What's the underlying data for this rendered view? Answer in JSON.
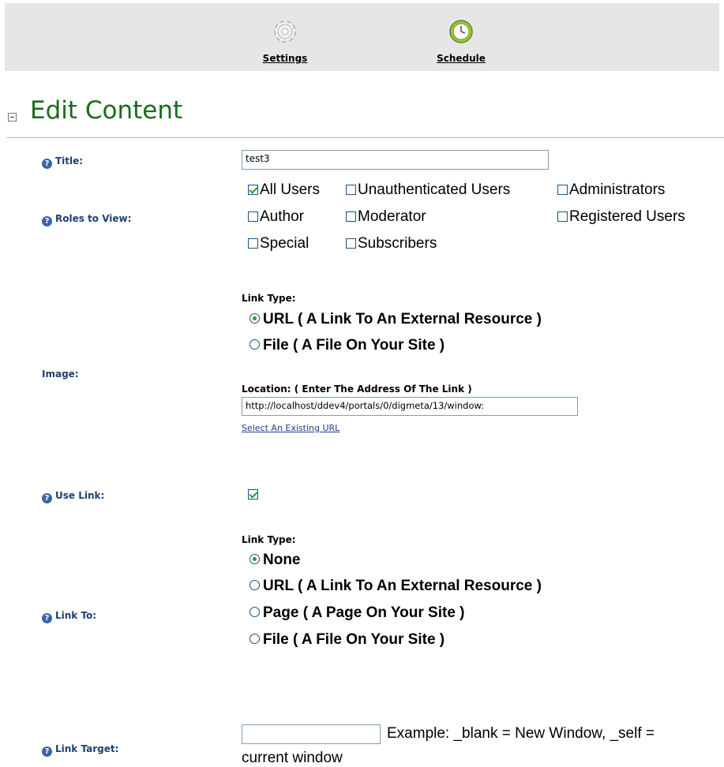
{
  "toolbar": {
    "settings_label": "Settings",
    "schedule_label": "Schedule"
  },
  "section": {
    "title": "Edit Content"
  },
  "fields": {
    "title": {
      "label": "Title:",
      "value": "test3"
    },
    "roles": {
      "label": "Roles to View:",
      "items": [
        {
          "label": "All Users",
          "checked": true
        },
        {
          "label": "Unauthenticated Users",
          "checked": false
        },
        {
          "label": "Administrators",
          "checked": false
        },
        {
          "label": "Author",
          "checked": false
        },
        {
          "label": "Moderator",
          "checked": false
        },
        {
          "label": "Registered Users",
          "checked": false
        },
        {
          "label": "Special",
          "checked": false
        },
        {
          "label": "Subscribers",
          "checked": false
        }
      ]
    },
    "image": {
      "label": "Image:",
      "link_type_label": "Link Type:",
      "options": [
        {
          "label": "URL ( A Link To An External Resource )",
          "selected": true
        },
        {
          "label": "File ( A File On Your Site )",
          "selected": false
        }
      ],
      "location_label": "Location: ( Enter The Address Of The Link )",
      "location_value": "http://localhost/ddev4/portals/0/digmeta/13/window:",
      "select_existing": "Select An Existing URL"
    },
    "use_link": {
      "label": "Use Link:",
      "checked": true
    },
    "link_to": {
      "label": "Link To:",
      "link_type_label": "Link Type:",
      "options": [
        {
          "label": "None",
          "selected": true
        },
        {
          "label": "URL ( A Link To An External Resource )",
          "selected": false
        },
        {
          "label": "Page ( A Page On Your Site )",
          "selected": false
        },
        {
          "label": "File ( A File On Your Site )",
          "selected": false
        }
      ]
    },
    "link_target": {
      "label": "Link Target:",
      "value": "",
      "hint_line1": "Example: _blank = New Window, _self =",
      "hint_line2": "current window"
    }
  },
  "icons": {
    "settings": "gear-icon",
    "schedule": "clock-icon",
    "help": "help-icon",
    "collapse": "collapse-icon"
  },
  "colors": {
    "title_green": "#1c6b1c",
    "label_blue": "#1e3f6e",
    "link_blue": "#1a3f93",
    "toolbar_bg": "#e6e6e6"
  }
}
